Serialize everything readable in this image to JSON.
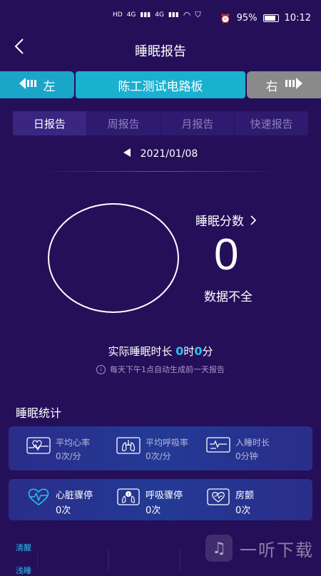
{
  "status_bar": {
    "left_tags": [
      "HD",
      "4G",
      "4G"
    ],
    "battery": "95%",
    "time": "10:12"
  },
  "header": {
    "title": "睡眠报告"
  },
  "device_bar": {
    "left_label": "左",
    "device_name": "陈工测试电路板",
    "right_label": "右"
  },
  "tabs": [
    {
      "label": "日报告"
    },
    {
      "label": "周报告"
    },
    {
      "label": "月报告"
    },
    {
      "label": "快速报告"
    }
  ],
  "date": "2021/01/08",
  "score": {
    "label": "睡眠分数",
    "value": "0",
    "note": "数据不全"
  },
  "actual_sleep": {
    "label": "实际睡眠时长",
    "hours": "0",
    "hour_unit": "时",
    "minutes": "0",
    "minute_unit": "分"
  },
  "hint": "每天下午1点自动生成前一天报告",
  "stats": {
    "title": "睡眠统计",
    "row1": [
      {
        "name": "平均心率",
        "value": "0",
        "unit": "次/分"
      },
      {
        "name": "平均呼吸率",
        "value": "0",
        "unit": "次/分"
      },
      {
        "name": "入睡时长",
        "value": "0",
        "unit": "分钟"
      }
    ],
    "row2": [
      {
        "name": "心脏骤停",
        "value": "0",
        "unit": "次"
      },
      {
        "name": "呼吸骤停",
        "value": "0",
        "unit": "次"
      },
      {
        "name": "房颤",
        "value": "0",
        "unit": "次"
      }
    ]
  },
  "chart": {
    "labels": [
      "清醒",
      "浅睡"
    ]
  },
  "watermark": "一听下载",
  "colors": {
    "background": "#250f59",
    "accent_blue": "#27c3f0",
    "device_bar_blue": "#1ab0d0",
    "device_bar_gray": "#8a8a8a"
  }
}
